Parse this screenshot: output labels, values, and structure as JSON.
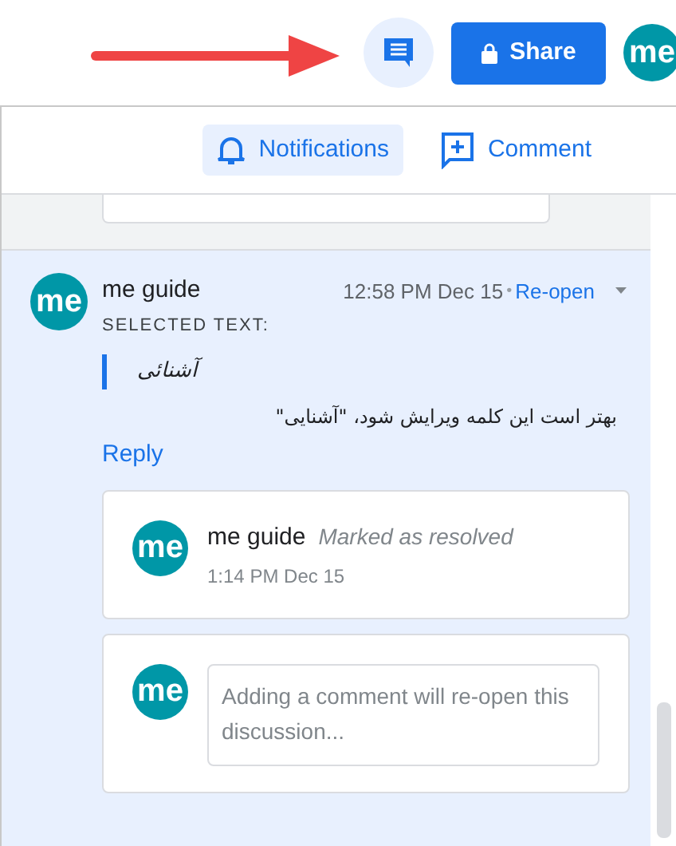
{
  "top_bar": {
    "share_button": {
      "label": "Share"
    },
    "avatar": {
      "initials": "me"
    }
  },
  "panel": {
    "header_buttons": [
      {
        "kind": "bell",
        "label": "Notifications",
        "selected": true
      },
      {
        "kind": "add-comment",
        "label": "Comment",
        "selected": false
      }
    ],
    "thread": {
      "avatar": {
        "initials": "me"
      },
      "author": "me guide",
      "time": "12:58 PM Dec 15",
      "separator": "•",
      "action": "Re-open",
      "selected_text_label": "SELECTED TEXT:",
      "selected_text": "آشنائی",
      "comment": "بهتر است این کلمه ویرایش شود، \"آشنایی\"",
      "reply": "Reply",
      "replies": [
        {
          "kind": "status",
          "initials": "me",
          "author": "me guide",
          "status": "Marked as resolved",
          "time": "1:14 PM Dec 15"
        },
        {
          "kind": "input",
          "initials": "me",
          "placeholder": "Adding a comment will re-open this discussion..."
        }
      ]
    }
  }
}
